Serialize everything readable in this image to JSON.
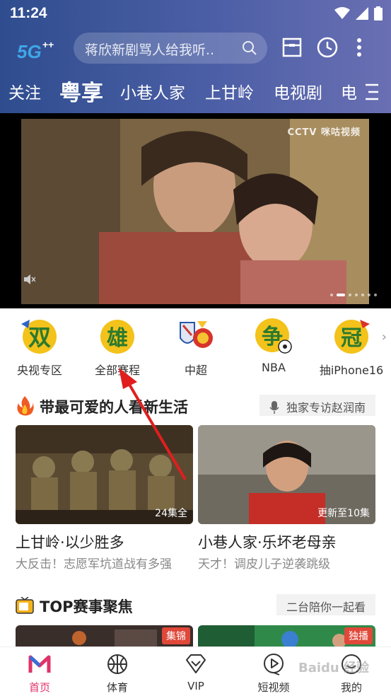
{
  "status_bar": {
    "time": "11:24"
  },
  "top_bar": {
    "logo_text": "5G",
    "search_placeholder": "蒋欣新剧骂人给我听.."
  },
  "tabs": [
    {
      "label": "关注"
    },
    {
      "label": "粤享"
    },
    {
      "label": "小巷人家"
    },
    {
      "label": "上甘岭"
    },
    {
      "label": "电视剧"
    },
    {
      "label": "电"
    }
  ],
  "banner": {
    "watermark": "CCTV 咪咕视频"
  },
  "categories": [
    {
      "label": "央视专区",
      "glyph": "双"
    },
    {
      "label": "全部赛程",
      "glyph": "雄"
    },
    {
      "label": "中超",
      "glyph": ""
    },
    {
      "label": "NBA",
      "glyph": "争"
    },
    {
      "label": "抽iPhone16",
      "glyph": "冠"
    }
  ],
  "section1": {
    "title": "带最可爱的人看新生活",
    "tag": "独家专访赵润南",
    "cards": [
      {
        "badge": "24集全",
        "title": "上甘岭·以少胜多",
        "subtitle": "大反击！志愿军坑道战有多强"
      },
      {
        "badge": "更新至10集",
        "title": "小巷人家·乐坏老母亲",
        "subtitle": "天才！调皮儿子逆袭跳级"
      }
    ]
  },
  "section2": {
    "title": "TOP赛事聚焦",
    "tag": "二台陪你一起看",
    "cards": [
      {
        "badge": "集锦"
      },
      {
        "badge": "独播"
      }
    ]
  },
  "bottom_nav": [
    {
      "label": "首页"
    },
    {
      "label": "体育"
    },
    {
      "label": "VIP"
    },
    {
      "label": "短视频"
    },
    {
      "label": "我的"
    }
  ],
  "colors": {
    "accent": "#e0336a",
    "header_start": "#2f4d8e",
    "header_end": "#6a6fb3"
  },
  "watermark": "Baidu 经验"
}
